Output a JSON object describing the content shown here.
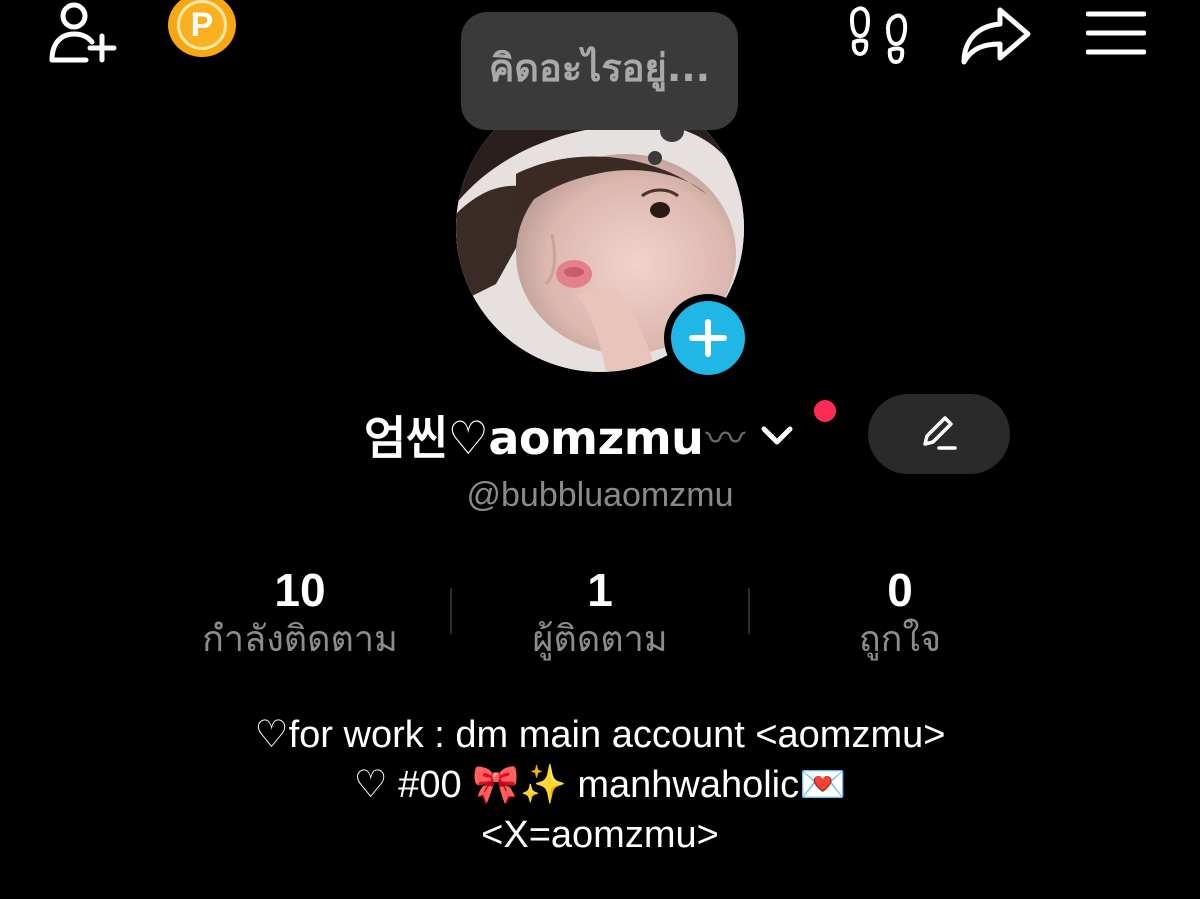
{
  "topbar": {
    "add_friend_icon": "person-plus-icon",
    "points_icon": "points-coin-icon",
    "points_letter": "P",
    "footprints_icon": "footprints-icon",
    "share_icon": "share-arrow-icon",
    "menu_icon": "hamburger-menu-icon"
  },
  "note_bubble": {
    "text": "คิดอะไรอยู่..."
  },
  "profile": {
    "display_name": "엄씬♡aomzmu",
    "name_suffix": "〰",
    "handle": "@bubbluaomzmu",
    "notification_color": "#ff2b55",
    "add_story_color": "#20b7e6"
  },
  "stats": [
    {
      "value": "10",
      "label": "กำลังติดตาม"
    },
    {
      "value": "1",
      "label": "ผู้ติดตาม"
    },
    {
      "value": "0",
      "label": "ถูกใจ"
    }
  ],
  "bio": {
    "line1": "♡for work : dm main account <aomzmu>",
    "line2": "♡ #00 🎀✨ manhwaholic💌",
    "line3": "<X=aomzmu>"
  }
}
